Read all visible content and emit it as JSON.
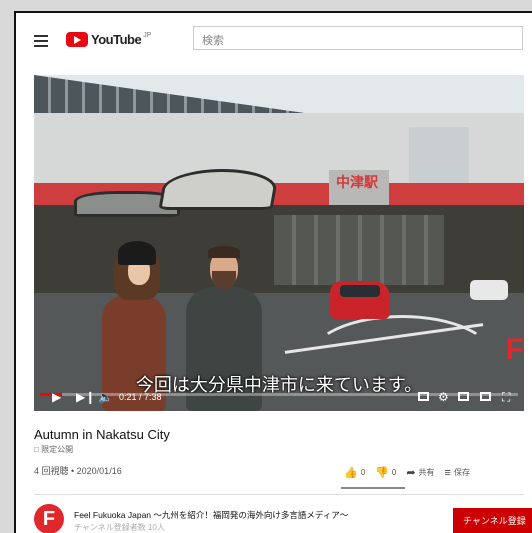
{
  "header": {
    "logo_text": "YouTube",
    "logo_region": "JP",
    "search_placeholder": "検索"
  },
  "video": {
    "subtitle": "今回は大分県中津市に来ています。",
    "station_sign": "中津駅",
    "current_time": "0:21",
    "duration": "7:38",
    "time_display": "0:21 / 7:38",
    "progress_fraction": 0.046,
    "corner_logo": "F"
  },
  "info": {
    "title": "Autumn in Nakatsu City",
    "limited_badge": "限定公開",
    "stats": "4 回視聴 • 2020/01/16",
    "like_count": "0",
    "dislike_count": "0",
    "share_label": "共有",
    "save_label": "保存"
  },
  "channel": {
    "avatar_letter": "F",
    "name": "Feel Fukuoka Japan ～九州を紹介！福岡発の海外向け多言語メディア～",
    "subscribers": "チャンネル登録者数 10人",
    "subscribe_label": "チャンネル登録"
  },
  "colors": {
    "brand_red": "#e50914",
    "progress_red": "#ff0000",
    "subscribe_red": "#cc0000"
  }
}
